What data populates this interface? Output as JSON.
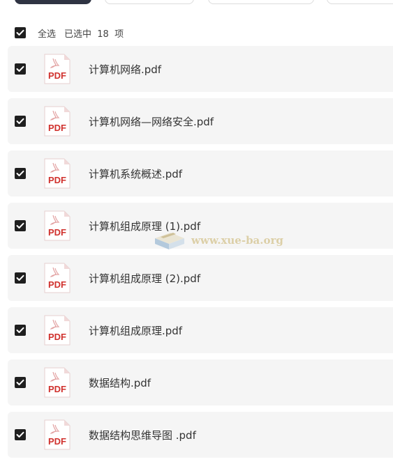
{
  "select_all": {
    "label": "全选",
    "selected_text": "已选中  18  项",
    "checked": true
  },
  "files": [
    {
      "name": "计算机网络.pdf",
      "checked": true,
      "icon": "pdf-icon"
    },
    {
      "name": "计算机网络—网络安全.pdf",
      "checked": true,
      "icon": "pdf-icon"
    },
    {
      "name": "计算机系统概述.pdf",
      "checked": true,
      "icon": "pdf-icon"
    },
    {
      "name": "计算机组成原理 (1).pdf",
      "checked": true,
      "icon": "pdf-icon"
    },
    {
      "name": "计算机组成原理 (2).pdf",
      "checked": true,
      "icon": "pdf-icon"
    },
    {
      "name": "计算机组成原理.pdf",
      "checked": true,
      "icon": "pdf-icon"
    },
    {
      "name": "数据结构.pdf",
      "checked": true,
      "icon": "pdf-icon"
    },
    {
      "name": "数据结构思维导图 .pdf",
      "checked": true,
      "icon": "pdf-icon"
    }
  ],
  "pdf_badge_text": "PDF",
  "watermark": {
    "text": "www.xue-ba.org"
  },
  "colors": {
    "checkbox": "#1f1f1f",
    "row_background": "#f5f5f5",
    "pdf_red": "#d0312d",
    "primary_button": "#2f3443"
  }
}
